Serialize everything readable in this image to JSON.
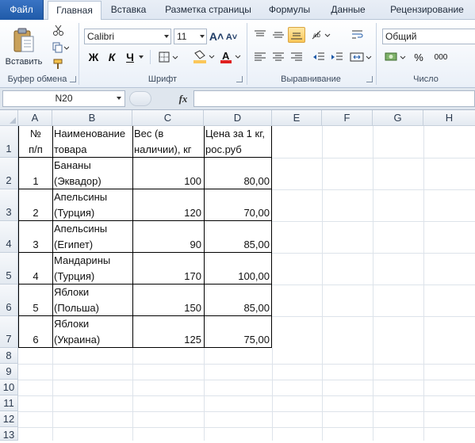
{
  "tabs": [
    {
      "label": "Файл"
    },
    {
      "label": "Главная"
    },
    {
      "label": "Вставка"
    },
    {
      "label": "Разметка страницы"
    },
    {
      "label": "Формулы"
    },
    {
      "label": "Данные"
    },
    {
      "label": "Рецензирование"
    }
  ],
  "ribbon": {
    "clipboard": {
      "paste_label": "Вставить",
      "group_label": "Буфер обмена"
    },
    "font": {
      "font_name": "Calibri",
      "font_size": "11",
      "bold": "Ж",
      "italic": "К",
      "underline": "Ч",
      "group_label": "Шрифт"
    },
    "alignment": {
      "group_label": "Выравнивание"
    },
    "number": {
      "format": "Общий",
      "percent": "%",
      "thousands": "000",
      "group_label": "Число"
    }
  },
  "formula_bar": {
    "name_box": "N20",
    "fx_label": "fx",
    "value": ""
  },
  "sheet": {
    "columns": [
      "A",
      "B",
      "C",
      "D",
      "E",
      "F",
      "G",
      "H"
    ],
    "rows": [
      "1",
      "2",
      "3",
      "4",
      "5",
      "6",
      "7",
      "8",
      "9",
      "10",
      "11",
      "12",
      "13"
    ],
    "header": {
      "a": "№\nп/п",
      "b": "Наименование\nтовара",
      "c": "Вес (в\nналичии), кг",
      "d": "Цена за 1 кг,\nрос.руб"
    },
    "data": [
      {
        "num": "1",
        "name": "Бананы\n(Эквадор)",
        "weight": "100",
        "price": "80,00"
      },
      {
        "num": "2",
        "name": "Апельсины\n(Турция)",
        "weight": "120",
        "price": "70,00"
      },
      {
        "num": "3",
        "name": "Апельсины\n(Египет)",
        "weight": "90",
        "price": "85,00"
      },
      {
        "num": "4",
        "name": "Мандарины\n(Турция)",
        "weight": "170",
        "price": "100,00"
      },
      {
        "num": "5",
        "name": "Яблоки\n(Польша)",
        "weight": "150",
        "price": "85,00"
      },
      {
        "num": "6",
        "name": "Яблоки\n(Украина)",
        "weight": "125",
        "price": "75,00"
      }
    ]
  },
  "colors": {
    "accent": "#1f5aa8",
    "fill": "#fbc75a",
    "font": "#e02020"
  }
}
